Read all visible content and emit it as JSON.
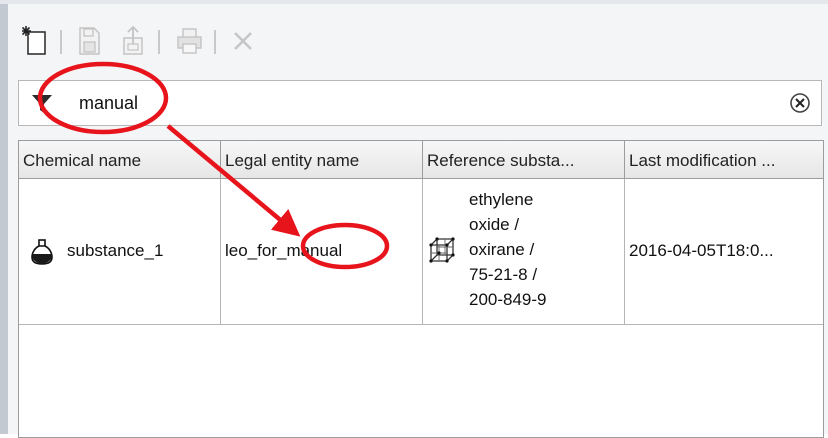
{
  "toolbar": {
    "buttons": [
      {
        "icon": "new-document-icon",
        "enabled": true
      },
      {
        "icon": "save-icon",
        "enabled": false
      },
      {
        "icon": "export-icon",
        "enabled": false
      },
      {
        "icon": "print-icon",
        "enabled": false
      },
      {
        "icon": "delete-icon",
        "enabled": false
      }
    ]
  },
  "filter": {
    "value": "manual",
    "icon": "funnel-icon",
    "clear_icon": "clear-icon"
  },
  "table": {
    "columns": [
      "Chemical name",
      "Legal entity name",
      "Reference substa...",
      "Last modification ..."
    ],
    "rows": [
      {
        "chemical_name": "substance_1",
        "legal_entity_prefix": "leo_for_",
        "legal_entity_highlight": "manual",
        "reference_lines": [
          "ethylene",
          "oxide /",
          "oxirane /",
          "75-21-8 /",
          "200-849-9"
        ],
        "last_modified": "2016-04-05T18:0..."
      }
    ]
  },
  "colors": {
    "annotation": "#e8141c",
    "panel_bg": "#f4f5f7",
    "grid_border": "#9c9c9c"
  }
}
